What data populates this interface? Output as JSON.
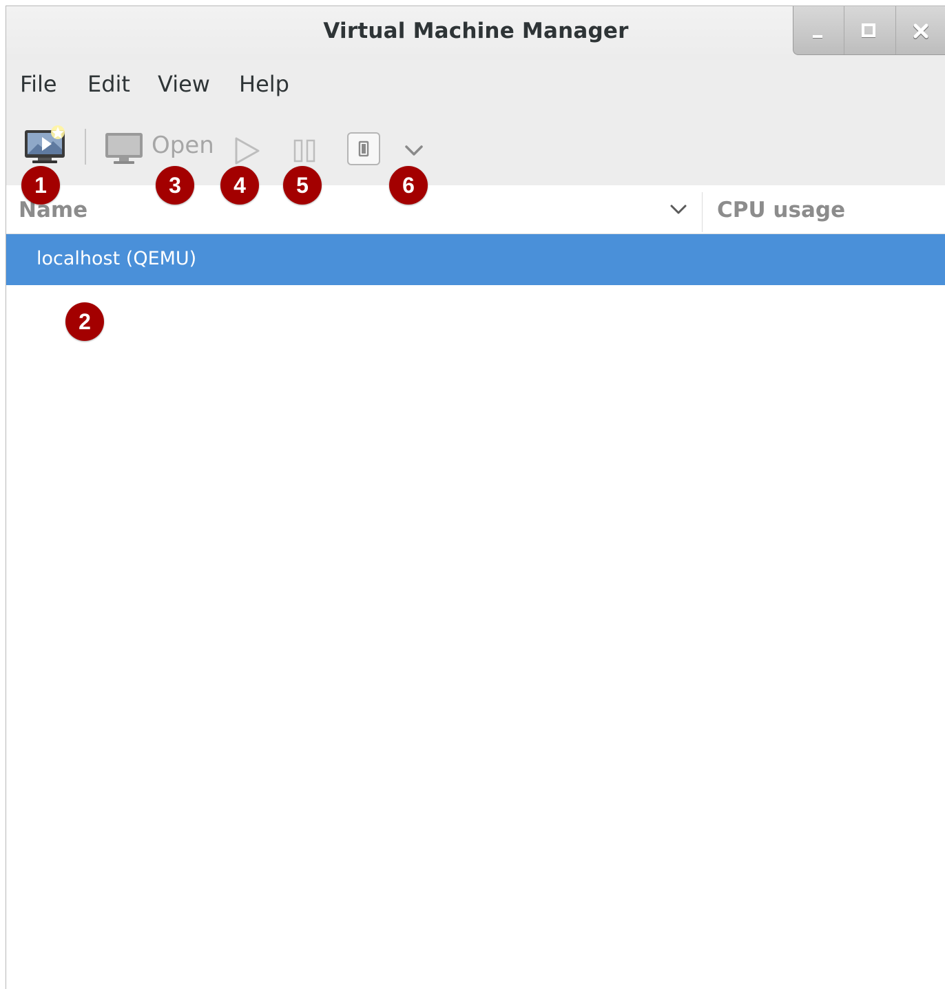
{
  "window": {
    "title": "Virtual Machine Manager"
  },
  "menubar": {
    "items": [
      "File",
      "Edit",
      "View",
      "Help"
    ]
  },
  "toolbar": {
    "new_vm_icon": "new-vm-icon",
    "open_label": "Open",
    "run_icon": "play-icon",
    "pause_icon": "pause-icon",
    "shutdown_icon": "shutdown-icon",
    "shutdown_menu_icon": "chevron-down-icon"
  },
  "callouts": [
    "1",
    "2",
    "3",
    "4",
    "5",
    "6"
  ],
  "list": {
    "columns": [
      "Name",
      "CPU usage"
    ],
    "rows": [
      {
        "name": "localhost (QEMU)",
        "selected": true
      }
    ]
  },
  "colors": {
    "selection": "#4a90d9",
    "callout": "#a30000"
  }
}
